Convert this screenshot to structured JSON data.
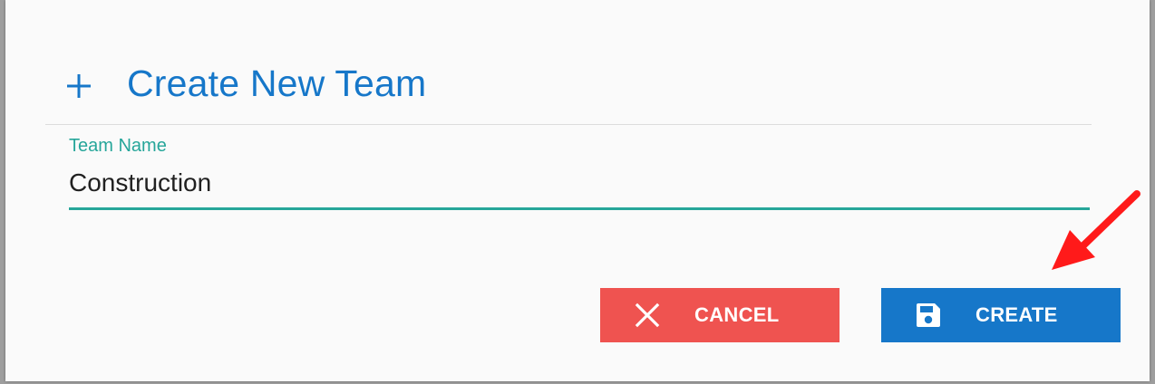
{
  "dialog": {
    "title": "Create New Team",
    "title_icon": "plus-icon"
  },
  "form": {
    "team_name": {
      "label": "Team Name",
      "value": "Construction"
    }
  },
  "actions": {
    "cancel": {
      "label": "CANCEL",
      "icon": "close-icon"
    },
    "create": {
      "label": "CREATE",
      "icon": "save-icon"
    }
  },
  "annotation": {
    "icon": "red-arrow-pointer"
  },
  "colors": {
    "primary": "#1677c9",
    "accent": "#26a69a",
    "danger": "#ef5350",
    "arrow": "#ff1a1a",
    "dialog_bg": "#fafafa"
  }
}
